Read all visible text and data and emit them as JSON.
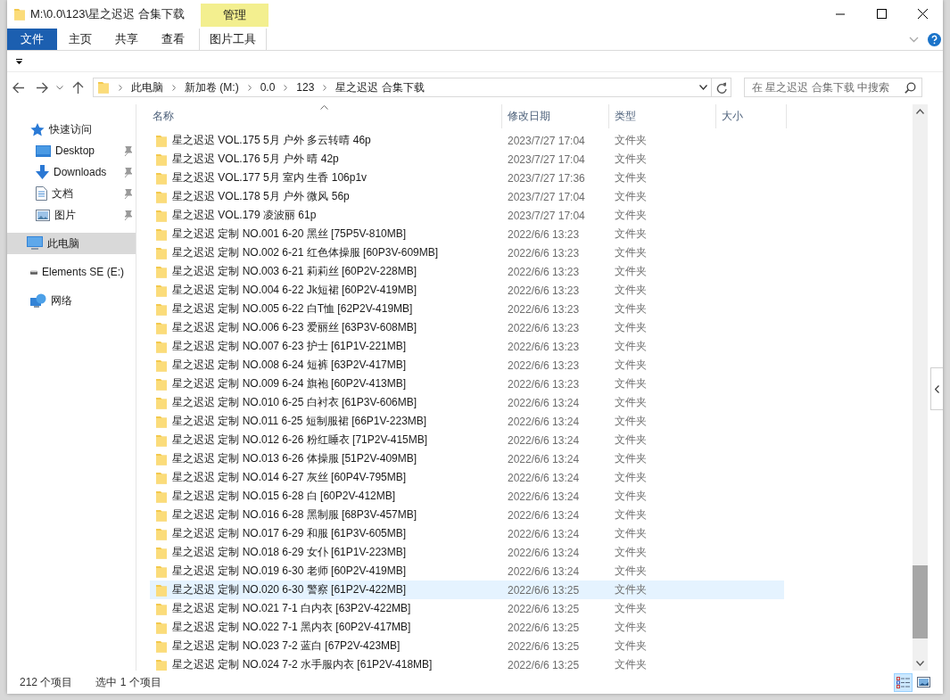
{
  "window": {
    "title": "M:\\0.0\\123\\星之迟迟 合集下载"
  },
  "ribbon": {
    "context_group": "管理",
    "tabs": [
      {
        "label": "文件",
        "kind": "file"
      },
      {
        "label": "主页",
        "kind": "tab"
      },
      {
        "label": "共享",
        "kind": "tab"
      },
      {
        "label": "查看",
        "kind": "tab"
      },
      {
        "label": "图片工具",
        "kind": "context"
      }
    ]
  },
  "address_bar": {
    "breadcrumbs": [
      "此电脑",
      "新加卷 (M:)",
      "0.0",
      "123",
      "星之迟迟 合集下载"
    ]
  },
  "search": {
    "placeholder": "在 星之迟迟 合集下载 中搜索"
  },
  "nav_pane": {
    "items": [
      {
        "label": "快速访问",
        "kind": "quick-access",
        "pinned": false,
        "selected": false
      },
      {
        "label": "Desktop",
        "kind": "desktop",
        "pinned": true,
        "selected": false
      },
      {
        "label": "Downloads",
        "kind": "downloads",
        "pinned": true,
        "selected": false
      },
      {
        "label": "文档",
        "kind": "documents",
        "pinned": true,
        "selected": false
      },
      {
        "label": "图片",
        "kind": "pictures",
        "pinned": true,
        "selected": false
      },
      {
        "label": "此电脑",
        "kind": "computer",
        "pinned": false,
        "selected": true
      },
      {
        "label": "Elements SE (E:)",
        "kind": "drive",
        "pinned": false,
        "selected": false
      },
      {
        "label": "网络",
        "kind": "network",
        "pinned": false,
        "selected": false
      }
    ]
  },
  "file_list": {
    "columns": [
      {
        "label": "名称",
        "sorted": true
      },
      {
        "label": "修改日期",
        "sorted": false
      },
      {
        "label": "类型",
        "sorted": false
      },
      {
        "label": "大小",
        "sorted": false
      }
    ],
    "rows": [
      {
        "name": "星之迟迟 VOL.175 5月 户外 多云转晴 46p",
        "modified": "2023/7/27 17:04",
        "type": "文件夹",
        "selected": false
      },
      {
        "name": "星之迟迟 VOL.176 5月 户外 晴 42p",
        "modified": "2023/7/27 17:04",
        "type": "文件夹",
        "selected": false
      },
      {
        "name": "星之迟迟 VOL.177 5月 室内 生香 106p1v",
        "modified": "2023/7/27 17:36",
        "type": "文件夹",
        "selected": false
      },
      {
        "name": "星之迟迟 VOL.178 5月 户外 微风 56p",
        "modified": "2023/7/27 17:04",
        "type": "文件夹",
        "selected": false
      },
      {
        "name": "星之迟迟 VOL.179 凌波丽 61p",
        "modified": "2023/7/27 17:04",
        "type": "文件夹",
        "selected": false
      },
      {
        "name": "星之迟迟 定制 NO.001 6-20 黑丝 [75P5V-810MB]",
        "modified": "2022/6/6 13:23",
        "type": "文件夹",
        "selected": false
      },
      {
        "name": "星之迟迟 定制 NO.002 6-21 红色体操服 [60P3V-609MB]",
        "modified": "2022/6/6 13:23",
        "type": "文件夹",
        "selected": false
      },
      {
        "name": "星之迟迟 定制 NO.003 6-21 莉莉丝 [60P2V-228MB]",
        "modified": "2022/6/6 13:23",
        "type": "文件夹",
        "selected": false
      },
      {
        "name": "星之迟迟 定制 NO.004 6-22 Jk短裙 [60P2V-419MB]",
        "modified": "2022/6/6 13:23",
        "type": "文件夹",
        "selected": false
      },
      {
        "name": "星之迟迟 定制 NO.005 6-22 白T恤 [62P2V-419MB]",
        "modified": "2022/6/6 13:23",
        "type": "文件夹",
        "selected": false
      },
      {
        "name": "星之迟迟 定制 NO.006 6-23 爱丽丝 [63P3V-608MB]",
        "modified": "2022/6/6 13:23",
        "type": "文件夹",
        "selected": false
      },
      {
        "name": "星之迟迟 定制 NO.007 6-23 护士 [61P1V-221MB]",
        "modified": "2022/6/6 13:23",
        "type": "文件夹",
        "selected": false
      },
      {
        "name": "星之迟迟 定制 NO.008 6-24 短裤 [63P2V-417MB]",
        "modified": "2022/6/6 13:23",
        "type": "文件夹",
        "selected": false
      },
      {
        "name": "星之迟迟 定制 NO.009 6-24 旗袍 [60P2V-413MB]",
        "modified": "2022/6/6 13:23",
        "type": "文件夹",
        "selected": false
      },
      {
        "name": "星之迟迟 定制 NO.010 6-25 白衬衣 [61P3V-606MB]",
        "modified": "2022/6/6 13:24",
        "type": "文件夹",
        "selected": false
      },
      {
        "name": "星之迟迟 定制 NO.011 6-25 短制服裙 [66P1V-223MB]",
        "modified": "2022/6/6 13:24",
        "type": "文件夹",
        "selected": false
      },
      {
        "name": "星之迟迟 定制 NO.012 6-26 粉红睡衣 [71P2V-415MB]",
        "modified": "2022/6/6 13:24",
        "type": "文件夹",
        "selected": false
      },
      {
        "name": "星之迟迟 定制 NO.013 6-26 体操服 [51P2V-409MB]",
        "modified": "2022/6/6 13:24",
        "type": "文件夹",
        "selected": false
      },
      {
        "name": "星之迟迟 定制 NO.014 6-27 灰丝 [60P4V-795MB]",
        "modified": "2022/6/6 13:24",
        "type": "文件夹",
        "selected": false
      },
      {
        "name": "星之迟迟 定制 NO.015 6-28 白 [60P2V-412MB]",
        "modified": "2022/6/6 13:24",
        "type": "文件夹",
        "selected": false
      },
      {
        "name": "星之迟迟 定制 NO.016 6-28 黑制服 [68P3V-457MB]",
        "modified": "2022/6/6 13:24",
        "type": "文件夹",
        "selected": false
      },
      {
        "name": "星之迟迟 定制 NO.017 6-29 和服 [61P3V-605MB]",
        "modified": "2022/6/6 13:24",
        "type": "文件夹",
        "selected": false
      },
      {
        "name": "星之迟迟 定制 NO.018 6-29 女仆 [61P1V-223MB]",
        "modified": "2022/6/6 13:24",
        "type": "文件夹",
        "selected": false
      },
      {
        "name": "星之迟迟 定制 NO.019 6-30 老师 [60P2V-419MB]",
        "modified": "2022/6/6 13:24",
        "type": "文件夹",
        "selected": false
      },
      {
        "name": "星之迟迟 定制 NO.020 6-30 警察 [61P2V-422MB]",
        "modified": "2022/6/6 13:25",
        "type": "文件夹",
        "selected": true
      },
      {
        "name": "星之迟迟 定制 NO.021 7-1 白内衣 [63P2V-422MB]",
        "modified": "2022/6/6 13:25",
        "type": "文件夹",
        "selected": false
      },
      {
        "name": "星之迟迟 定制 NO.022 7-1 黑内衣 [60P2V-417MB]",
        "modified": "2022/6/6 13:25",
        "type": "文件夹",
        "selected": false
      },
      {
        "name": "星之迟迟 定制 NO.023 7-2 蓝白 [67P2V-423MB]",
        "modified": "2022/6/6 13:25",
        "type": "文件夹",
        "selected": false
      },
      {
        "name": "星之迟迟 定制 NO.024 7-2 水手服内衣 [61P2V-418MB]",
        "modified": "2022/6/6 13:25",
        "type": "文件夹",
        "selected": false
      }
    ]
  },
  "status_bar": {
    "item_count": "212 个项目",
    "selection": "选中 1 个项目",
    "views": [
      {
        "kind": "details",
        "selected": true
      },
      {
        "kind": "large-icons",
        "selected": false
      }
    ]
  }
}
